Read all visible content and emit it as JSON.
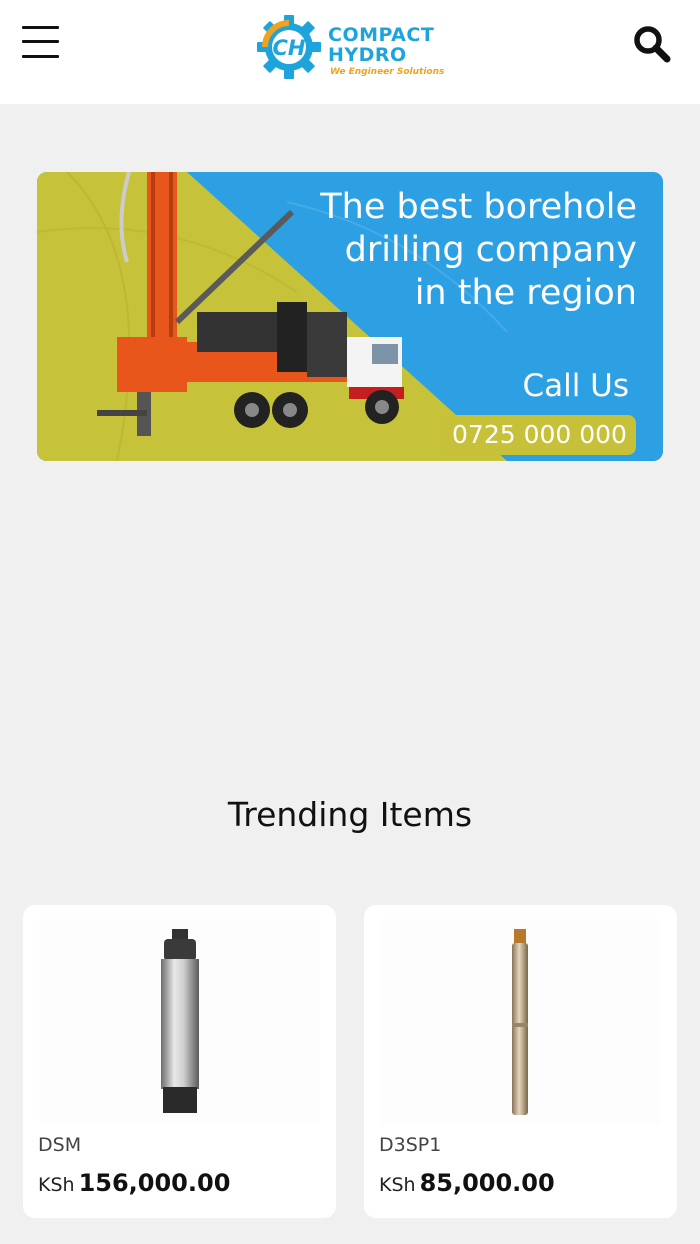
{
  "header": {
    "logo_line1": "COMPACT",
    "logo_line2": "HYDRO",
    "logo_tagline": "We Engineer Solutions",
    "logo_monogram": "CH",
    "brand_blue": "#1ea4dc",
    "brand_orange": "#f0a21e"
  },
  "banner": {
    "headline_lines": [
      "The best borehole",
      "drilling company",
      "in the region"
    ],
    "call_label": "Call Us",
    "phone": "0725 000 000"
  },
  "trending": {
    "title": "Trending Items",
    "items": [
      {
        "name": "DSM",
        "currency": "KSh",
        "price": "156,000.00"
      },
      {
        "name": "D3SP1",
        "currency": "KSh",
        "price": "85,000.00"
      }
    ]
  }
}
